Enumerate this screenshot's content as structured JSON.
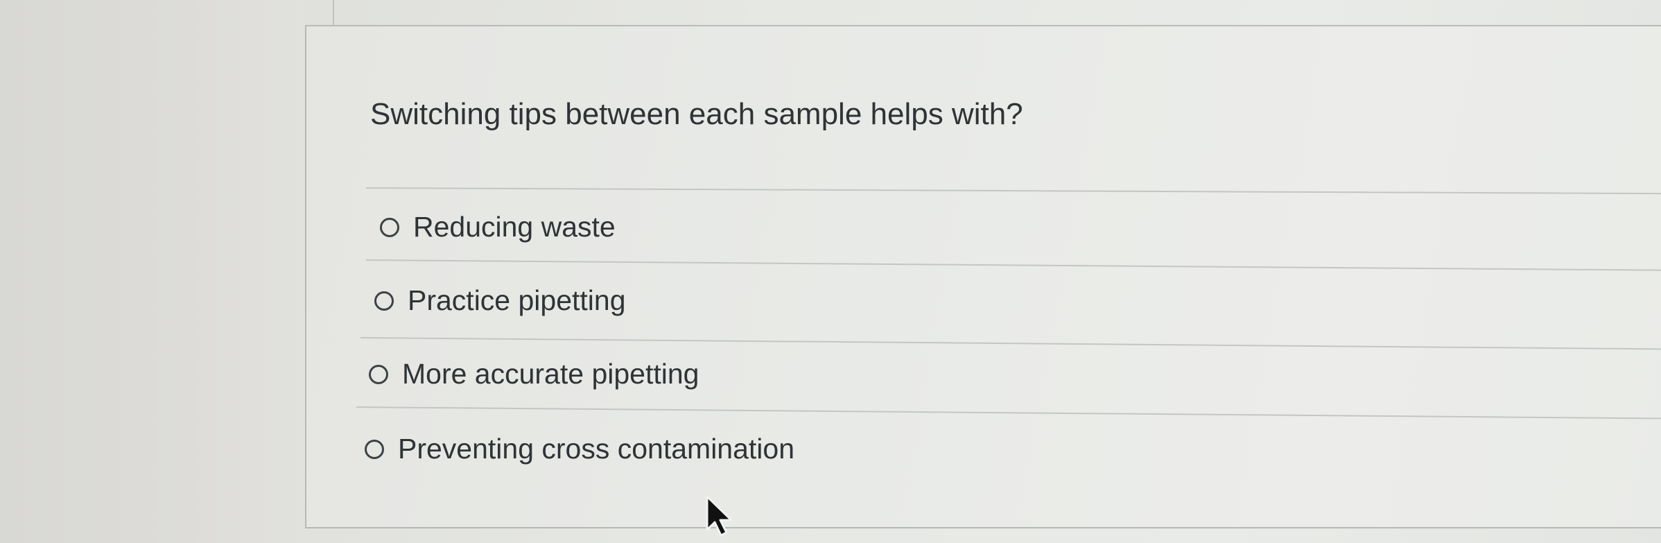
{
  "question": {
    "text": "Switching tips between each sample helps with?"
  },
  "options": [
    {
      "label": "Reducing waste",
      "selected": false
    },
    {
      "label": "Practice pipetting",
      "selected": false
    },
    {
      "label": "More accurate pipetting",
      "selected": false
    },
    {
      "label": "Preventing cross contamination",
      "selected": false
    }
  ],
  "icons": {
    "cursor": "mouse-pointer-icon",
    "radio": "radio-button-unselected-icon"
  }
}
